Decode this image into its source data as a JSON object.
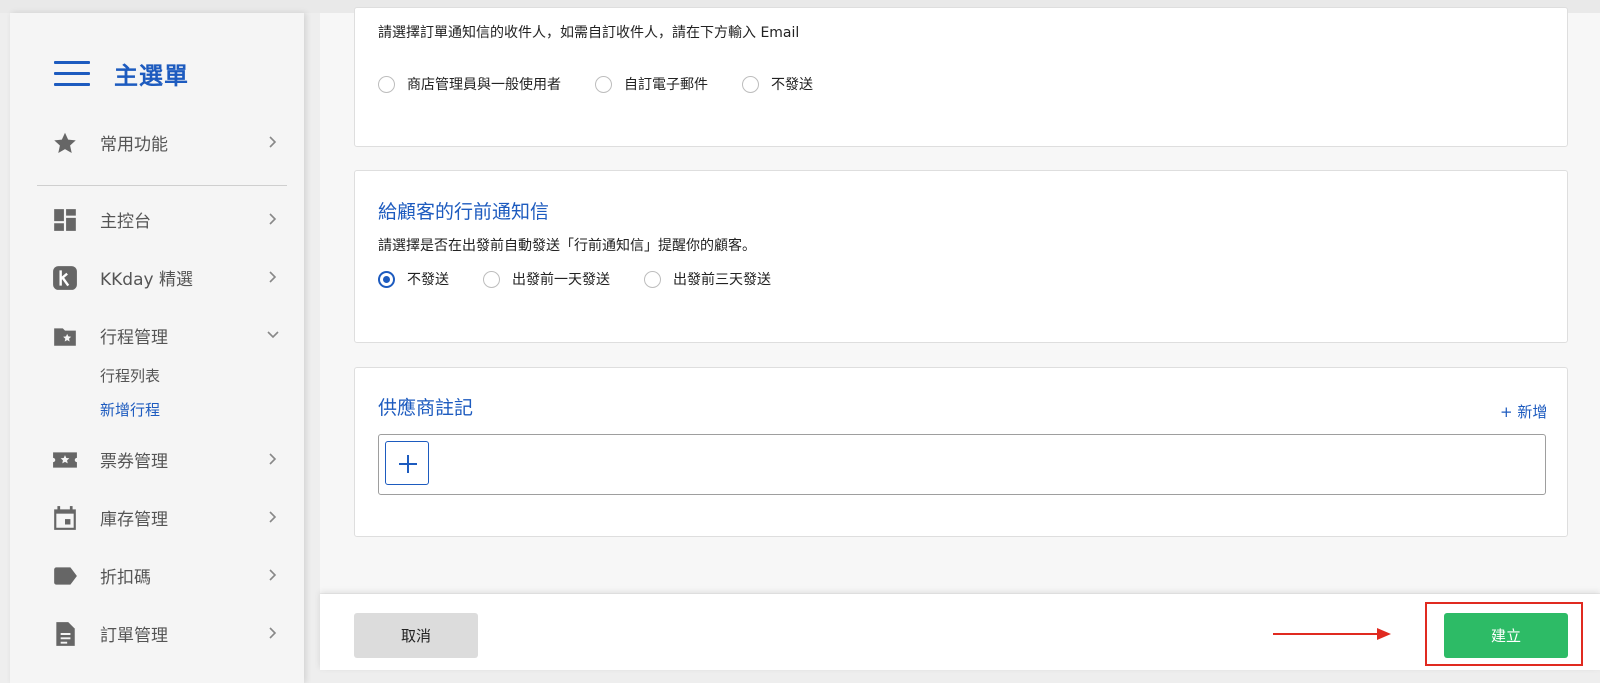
{
  "sidebar": {
    "menu_title": "主選單",
    "items": [
      {
        "label": "常用功能",
        "icon": "star-icon"
      },
      {
        "label": "主控台",
        "icon": "dashboard-icon"
      },
      {
        "label": "KKday 精選",
        "icon": "kkday-k-icon"
      },
      {
        "label": "行程管理",
        "icon": "folder-star-icon"
      },
      {
        "label": "票券管理",
        "icon": "ticket-icon"
      },
      {
        "label": "庫存管理",
        "icon": "calendar-icon"
      },
      {
        "label": "折扣碼",
        "icon": "tag-icon"
      },
      {
        "label": "訂單管理",
        "icon": "document-icon"
      }
    ],
    "sub_items": [
      {
        "label": "行程列表",
        "active": false
      },
      {
        "label": "新增行程",
        "active": true
      }
    ]
  },
  "order_notice": {
    "description": "請選擇訂單通知信的收件人，如需自訂收件人，請在下方輸入 Email",
    "options": [
      "商店管理員與一般使用者",
      "自訂電子郵件",
      "不發送"
    ],
    "selected": null
  },
  "pre_departure": {
    "title": "給顧客的行前通知信",
    "description": "請選擇是否在出發前自動發送「行前通知信」提醒你的顧客。",
    "options": [
      "不發送",
      "出發前一天發送",
      "出發前三天發送"
    ],
    "selected": "不發送"
  },
  "supplier_notes": {
    "title": "供應商註記",
    "add_label": "+ 新增"
  },
  "footer": {
    "cancel_label": "取消",
    "create_label": "建立"
  },
  "colors": {
    "accent": "#1d5bbf",
    "create_button": "#2dbb66",
    "highlight": "#e02a20"
  }
}
